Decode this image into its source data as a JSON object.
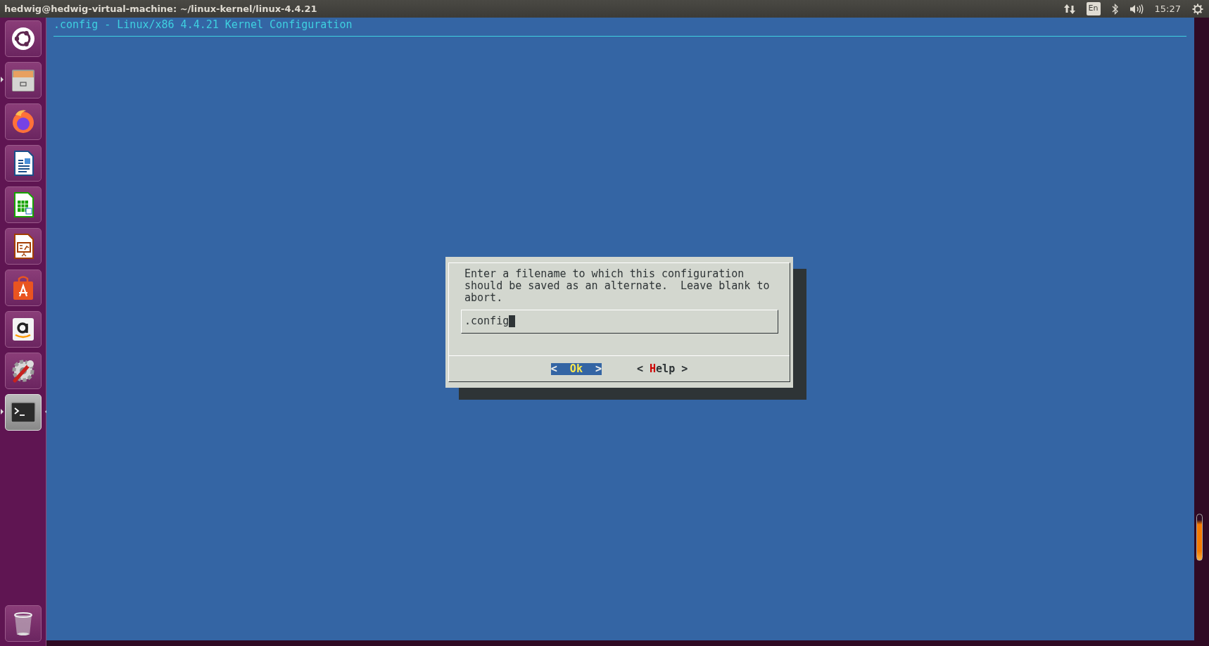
{
  "top_bar": {
    "title": "hedwig@hedwig-virtual-machine: ~/linux-kernel/linux-4.4.21",
    "keyboard_layout": "En",
    "clock": "15:27"
  },
  "launcher": {
    "items": [
      {
        "kind": "dash",
        "running": false,
        "focused": false
      },
      {
        "kind": "files",
        "running": true,
        "focused": false
      },
      {
        "kind": "browser",
        "running": false,
        "focused": false
      },
      {
        "kind": "writer",
        "running": false,
        "focused": false
      },
      {
        "kind": "calc",
        "running": false,
        "focused": false
      },
      {
        "kind": "impress",
        "running": false,
        "focused": false
      },
      {
        "kind": "store",
        "running": false,
        "focused": false
      },
      {
        "kind": "shop",
        "running": false,
        "focused": false
      },
      {
        "kind": "settings",
        "running": false,
        "focused": false
      },
      {
        "kind": "terminal",
        "running": true,
        "focused": true
      }
    ],
    "trash": {
      "kind": "trash"
    }
  },
  "terminal": {
    "header": ".config - Linux/x86 4.4.21 Kernel Configuration",
    "dialog": {
      "prompt": [
        "Enter a filename to which this configuration",
        "should be saved as an alternate.  Leave blank to",
        "abort."
      ],
      "input": {
        "value": ".config"
      },
      "buttons": [
        {
          "label": "<  Ok  >",
          "selected": true
        },
        {
          "label": "< Help >",
          "selected": false
        }
      ]
    }
  }
}
